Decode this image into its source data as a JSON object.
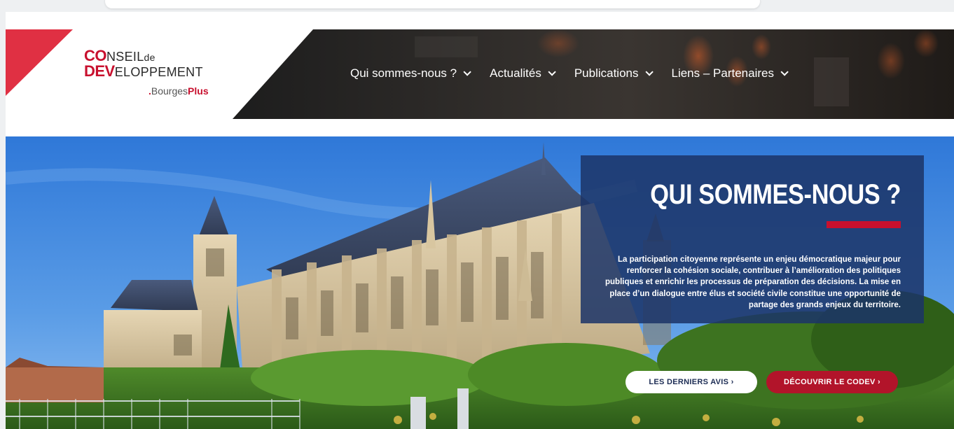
{
  "logo": {
    "co": "CO",
    "nseil": "NSEIL",
    "de": "de",
    "dev": "DEV",
    "eloppement": "ELOPPEMENT",
    "dot": ".",
    "bourges": "Bourges",
    "plus": "Plus"
  },
  "nav": {
    "items": [
      {
        "label": "Qui sommes-nous ?"
      },
      {
        "label": "Actualités"
      },
      {
        "label": "Publications"
      },
      {
        "label": "Liens – Partenaires"
      }
    ]
  },
  "hero": {
    "title": "QUI SOMMES-NOUS ?",
    "text": "La participation citoyenne représente un enjeu démocratique majeur pour renforcer la cohésion sociale, contribuer à l’amélioration des politiques publiques et enrichir les processus de préparation des décisions. La mise en place d’un dialogue entre élus et société civile constitue une opportunité de partage des grands enjeux du territoire.",
    "buttons": {
      "latest": "LES DERNIERS AVIS ›",
      "discover": "DÉCOUVRIR LE CODEV ›"
    }
  },
  "colors": {
    "brand_red": "#c8102e",
    "panel_blue": "#1c3468",
    "nav_dark": "#2a2a2a"
  }
}
